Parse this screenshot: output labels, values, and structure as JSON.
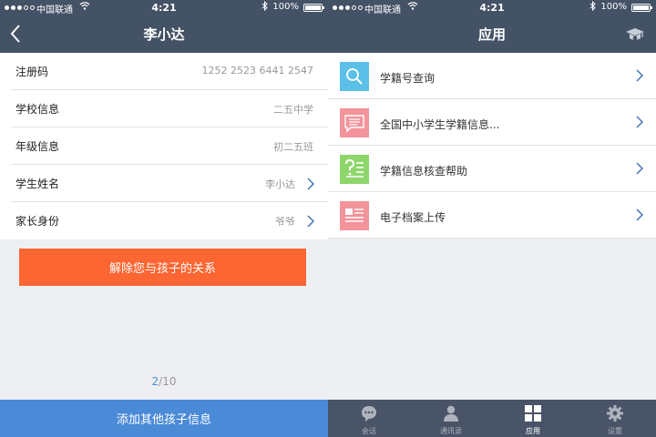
{
  "colors": {
    "nav_bar": "#445266",
    "tab_bar": "#4a5468",
    "unbind_button": "#fc6633",
    "add_button": "#4a8ad7",
    "pager_current": "#4a90d9",
    "icon_search_bg": "#5bc0e8",
    "icon_pink_bg": "#f3939a",
    "icon_green_bg": "#8ed66b"
  },
  "status_bar": {
    "carrier": "中国联通",
    "time": "4:21",
    "battery_pct": "100%",
    "battery_level": 1.0,
    "signal_bars_filled": 3,
    "signal_bars_total": 5
  },
  "left": {
    "title": "李小达",
    "rows": [
      {
        "label": "注册码",
        "value": "1252 2523 6441 2547",
        "chevron": false
      },
      {
        "label": "学校信息",
        "value": "二五中学",
        "chevron": false
      },
      {
        "label": "年级信息",
        "value": "初二五班",
        "chevron": false
      },
      {
        "label": "学生姓名",
        "value": "李小达",
        "chevron": true
      },
      {
        "label": "家长身份",
        "value": "爷爷",
        "chevron": true
      }
    ],
    "unbind_label": "解除您与孩子的关系",
    "pager": {
      "current": "2",
      "total": "/10"
    },
    "add_label": "添加其他孩子信息"
  },
  "right": {
    "title": "应用",
    "apps": [
      {
        "label": "学籍号查询",
        "icon": "search-icon"
      },
      {
        "label": "全国中小学生学籍信息...",
        "icon": "message-icon"
      },
      {
        "label": "学籍信息核查帮助",
        "icon": "help-list-icon"
      },
      {
        "label": "电子档案上传",
        "icon": "document-icon"
      }
    ],
    "tabs": [
      {
        "label": "会话",
        "icon": "chat-icon",
        "active": false
      },
      {
        "label": "通讯录",
        "icon": "contact-icon",
        "active": false
      },
      {
        "label": "应用",
        "icon": "apps-grid-icon",
        "active": true
      },
      {
        "label": "设置",
        "icon": "gear-icon",
        "active": false
      }
    ]
  }
}
